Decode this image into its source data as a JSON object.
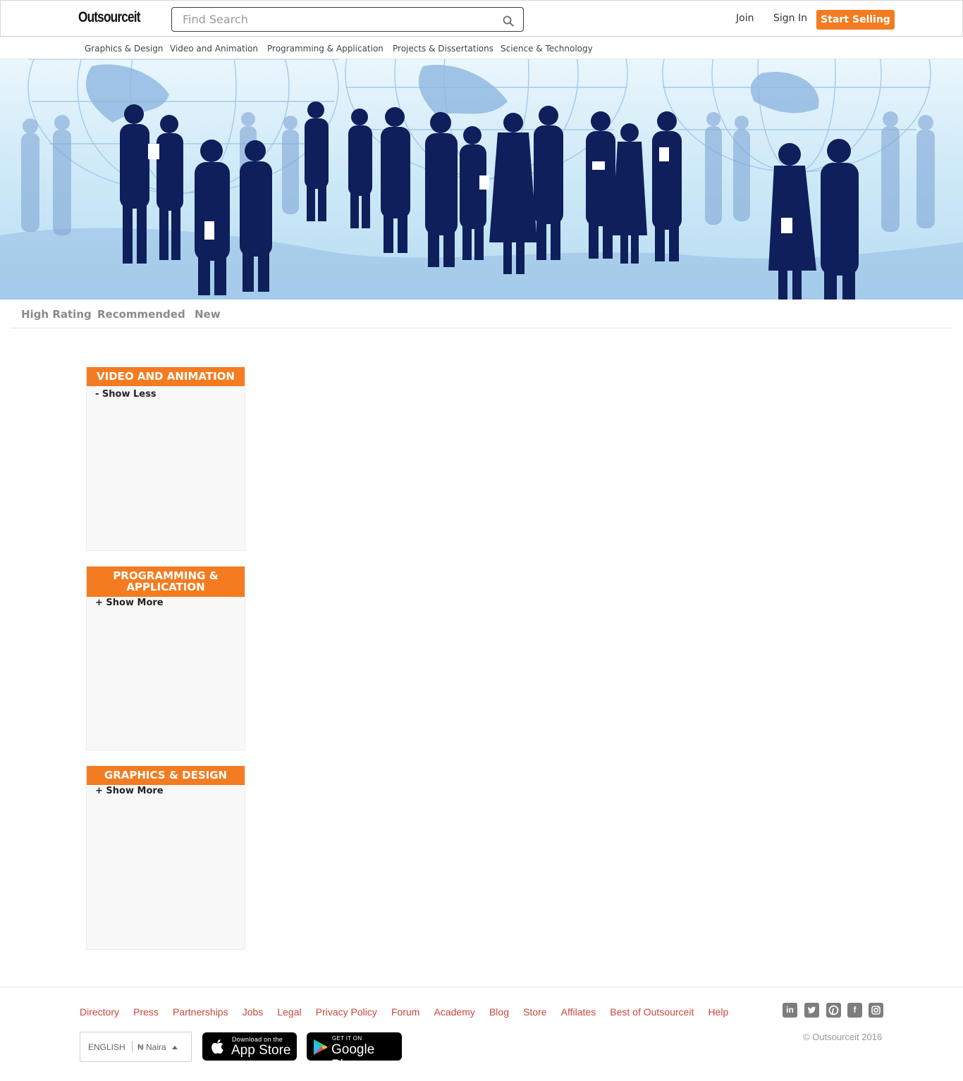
{
  "header": {
    "logo_text": "Outsourceit",
    "search_placeholder": "Find Search",
    "join_label": "Join",
    "signin_label": "Sign In",
    "start_selling_label": "Start Selling",
    "accent_color": "#f47b20"
  },
  "category_nav": [
    "Graphics & Design",
    "Video and Animation",
    "Programming & Application",
    "Projects & Dissertations",
    "Science & Technology"
  ],
  "filter_tabs": [
    "High Rating",
    "Recommended",
    "New"
  ],
  "panels": [
    {
      "title": "VIDEO AND ANIMATION",
      "toggle": "- Show Less"
    },
    {
      "title_line1": "PROGRAMMING &",
      "title_line2": "APPLICATION",
      "toggle": "+ Show More"
    },
    {
      "title": "GRAPHICS & DESIGN",
      "toggle": "+ Show More"
    }
  ],
  "footer": {
    "links": [
      "Directory",
      "Press",
      "Partnerships",
      "Jobs",
      "Legal",
      "Privacy Policy",
      "Forum",
      "Academy",
      "Blog",
      "Store",
      "Affilates",
      "Best of Outsourceit",
      "Help"
    ],
    "language": "ENGLISH",
    "currency": "₦ Naira",
    "app_store": {
      "small": "Download on the",
      "big": "App Store"
    },
    "google_play": {
      "small": "GET IT ON",
      "big": "Google Play"
    },
    "social_icons": [
      "linkedin-icon",
      "twitter-icon",
      "pinterest-icon",
      "facebook-icon",
      "instagram-icon"
    ],
    "copyright": "© Outsourceit 2016"
  }
}
